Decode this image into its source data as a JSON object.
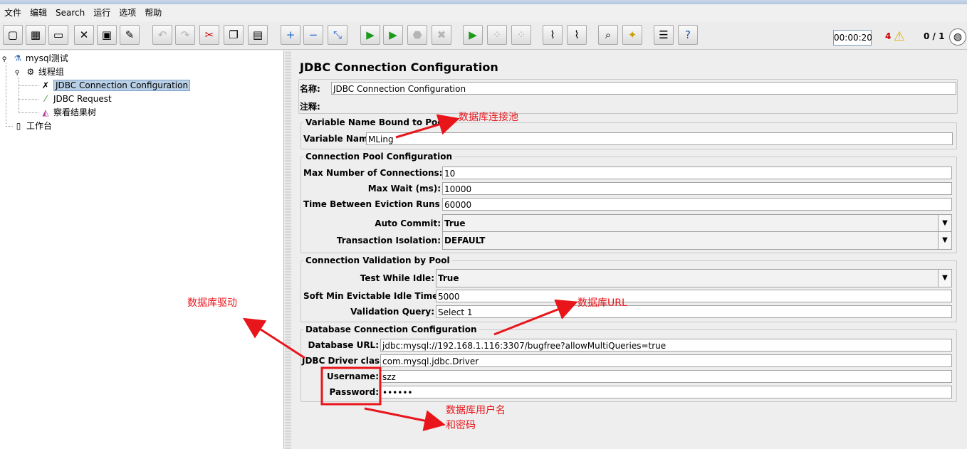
{
  "menu": [
    "文件",
    "编辑",
    "Search",
    "运行",
    "选项",
    "帮助"
  ],
  "toolbar": {
    "timer": "00:00:20",
    "error_count": "4",
    "threads": "0 / 1"
  },
  "tree": {
    "test_plan": "mysql测试",
    "thread_group": "线程组",
    "jdbc_config": "JDBC Connection Configuration",
    "jdbc_request": "JDBC Request",
    "results_tree": "察看结果树",
    "workbench": "工作台"
  },
  "panel": {
    "title": "JDBC Connection Configuration",
    "name_label": "名称:",
    "name_value": "JDBC Connection Configuration",
    "comments_label": "注释:",
    "pool_bound": {
      "title": "Variable Name Bound to Pool",
      "var_label": "Variable Name:",
      "var_value": "MLing"
    },
    "pool_config": {
      "title": "Connection Pool Configuration",
      "max_conn_label": "Max Number of Connections:",
      "max_conn_value": "10",
      "max_wait_label": "Max Wait (ms):",
      "max_wait_value": "10000",
      "eviction_label": "Time Between Eviction Runs (ms):",
      "eviction_value": "60000",
      "autocommit_label": "Auto Commit:",
      "autocommit_value": "True",
      "isolation_label": "Transaction Isolation:",
      "isolation_value": "DEFAULT"
    },
    "validation": {
      "title": "Connection Validation by Pool",
      "idle_label": "Test While Idle:",
      "idle_value": "True",
      "soft_min_label": "Soft Min Evictable Idle Time(ms):",
      "soft_min_value": "5000",
      "query_label": "Validation Query:",
      "query_value": "Select 1"
    },
    "db": {
      "title": "Database Connection Configuration",
      "url_label": "Database URL:",
      "url_value": "jdbc:mysql://192.168.1.116:3307/bugfree?allowMultiQueries=true",
      "driver_label": "JDBC Driver class:",
      "driver_value": "com.mysql.jdbc.Driver",
      "user_label": "Username:",
      "user_value": "szz",
      "pass_label": "Password:",
      "pass_value": "••••••"
    }
  },
  "annotations": {
    "pool": "数据库连接池",
    "driver": "数据库驱动",
    "url": "数据库URL",
    "userpass_line1": "数据库用户名",
    "userpass_line2": "和密码"
  },
  "colors": {
    "annotation": "#e8151b",
    "selection": "#b8cfe5"
  }
}
